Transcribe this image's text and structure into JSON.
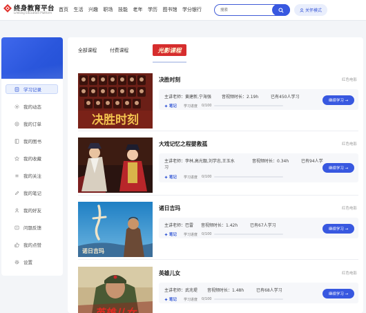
{
  "header": {
    "logo_title": "终身教育平台",
    "logo_subtitle": "Lifelong Education Platform",
    "nav": [
      "首页",
      "生活",
      "兴趣",
      "职场",
      "技能",
      "老年",
      "学历",
      "图书馆",
      "学分银行"
    ],
    "search_placeholder": "搜索",
    "care_mode": "关怀模式"
  },
  "sidebar": {
    "items": [
      {
        "label": "学习记录",
        "icon": "document-icon",
        "active": true
      },
      {
        "label": "我的动态",
        "icon": "activity-icon"
      },
      {
        "label": "我的订单",
        "icon": "order-icon"
      },
      {
        "label": "我的图书",
        "icon": "book-icon"
      },
      {
        "label": "我的收藏",
        "icon": "star-icon"
      },
      {
        "label": "我的关注",
        "icon": "follow-icon"
      },
      {
        "label": "我的笔记",
        "icon": "pen-icon"
      },
      {
        "label": "我的好友",
        "icon": "friends-icon"
      },
      {
        "label": "问题反馈",
        "icon": "feedback-icon"
      },
      {
        "label": "我的点赞",
        "icon": "thumbs-up-icon"
      },
      {
        "label": "设置",
        "icon": "gear-icon"
      }
    ]
  },
  "tabs": {
    "all": "全部课程",
    "paid": "付费课程",
    "logo_text": "光影课程"
  },
  "courses": [
    {
      "title": "决胜时刻",
      "category": "红色电影",
      "teacher": "主讲老师：黄建新,宁海强",
      "duration": "音视频时长：2.19h",
      "learners": "已有450人学习",
      "note": "笔记",
      "progress_label": "学习进度",
      "progress_value": "0/100",
      "button": "继续学习 →",
      "poster_text": "决胜时刻"
    },
    {
      "title": "大戏记忆之程婴救孤",
      "category": "红色电影",
      "teacher": "主讲老师：李林,高光靓,刘学忠,王玉水",
      "teacher_cont": "习",
      "duration": "音视频时长：0.34h",
      "learners": "已有94人学",
      "note": "笔记",
      "progress_label": "学习进度",
      "progress_value": "0/100",
      "button": "继续学习 →"
    },
    {
      "title": "诸日吉玛",
      "category": "红色电影",
      "teacher": "主讲老师：巴雷",
      "duration": "音视频时长：1.42h",
      "learners": "已有67人学习",
      "note": "笔记",
      "progress_label": "学习进度",
      "progress_value": "0/100",
      "button": "继续学习 →",
      "poster_text": "诺日吉玛"
    },
    {
      "title": "英雄儿女",
      "category": "红色电影",
      "teacher": "主讲老师：武兆堤",
      "duration": "音视频时长：1.48h",
      "learners": "已有68人学习",
      "note": "笔记",
      "progress_label": "学习进度",
      "progress_value": "0/100",
      "button": "继续学习 →",
      "poster_text": "英雄儿女"
    }
  ],
  "colors": {
    "primary": "#3858e0",
    "sidebar_banner": "#3f68ec",
    "logo_red": "#e0302b"
  }
}
